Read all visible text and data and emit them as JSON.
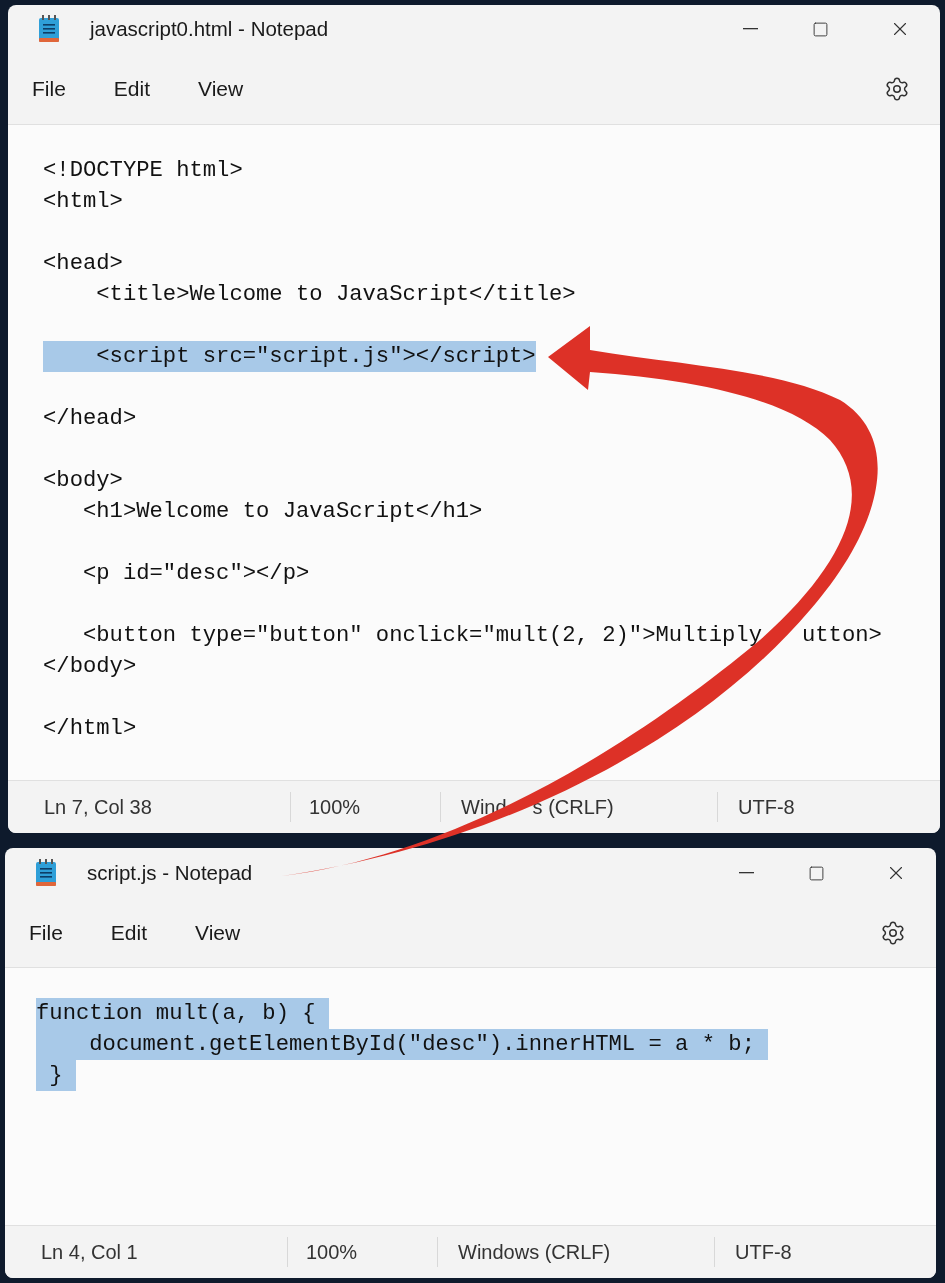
{
  "windows": [
    {
      "title": "javascript0.html - Notepad",
      "menu": [
        "File",
        "Edit",
        "View"
      ],
      "lines": [
        {
          "kind": "code",
          "parts": [
            "<!DOCTYPE html>"
          ],
          "selected": false
        },
        {
          "kind": "code",
          "parts": [
            "<html>"
          ],
          "selected": false
        },
        {
          "kind": "blank"
        },
        {
          "kind": "code",
          "parts": [
            "<head>"
          ],
          "selected": false
        },
        {
          "kind": "code",
          "parts": [
            "    <title>Welcome to JavaScript</title>"
          ],
          "selected": false
        },
        {
          "kind": "blank"
        },
        {
          "kind": "code",
          "parts": [
            "    <script src=\"script.js\"></script>"
          ],
          "selected": true
        },
        {
          "kind": "blank"
        },
        {
          "kind": "code",
          "parts": [
            "</head>"
          ],
          "selected": false
        },
        {
          "kind": "blank"
        },
        {
          "kind": "code",
          "parts": [
            "<body>"
          ],
          "selected": false
        },
        {
          "kind": "code",
          "parts": [
            "   <h1>Welcome to JavaScript</h1>"
          ],
          "selected": false
        },
        {
          "kind": "blank"
        },
        {
          "kind": "code",
          "parts": [
            "   <p id=\"desc\"></p>"
          ],
          "selected": false
        },
        {
          "kind": "blank"
        },
        {
          "kind": "code",
          "parts": [
            "   <button type=\"button\" onclick=\"mult(2, 2)\">Multiply",
            "utton>"
          ],
          "selected": false
        },
        {
          "kind": "code",
          "parts": [
            "</body>"
          ],
          "selected": false
        },
        {
          "kind": "blank"
        },
        {
          "kind": "code",
          "parts": [
            "</html>"
          ],
          "selected": false
        }
      ],
      "status_bar": [
        {
          "parts": [
            "Ln 7, Col 38"
          ]
        },
        {
          "parts": [
            "100%"
          ]
        },
        {
          "parts": [
            "Wind",
            "s (CRLF)"
          ]
        },
        {
          "parts": [
            "UTF-8"
          ]
        }
      ]
    },
    {
      "title": "script.js - Notepad",
      "menu": [
        "File",
        "Edit",
        "View"
      ],
      "lines": [
        {
          "kind": "code",
          "parts": [
            "function mult(a, b) { "
          ],
          "selected": true
        },
        {
          "kind": "code",
          "parts": [
            "    document.getElementById(\"desc\").innerHTML = a * b; "
          ],
          "selected": true
        },
        {
          "kind": "code",
          "parts": [
            " } "
          ],
          "selected": true
        }
      ],
      "status_bar": [
        {
          "parts": [
            "Ln 4, Col 1"
          ]
        },
        {
          "parts": [
            "100%"
          ]
        },
        {
          "parts": [
            "Windows (CRLF)"
          ]
        },
        {
          "parts": [
            "UTF-8"
          ]
        }
      ]
    }
  ]
}
